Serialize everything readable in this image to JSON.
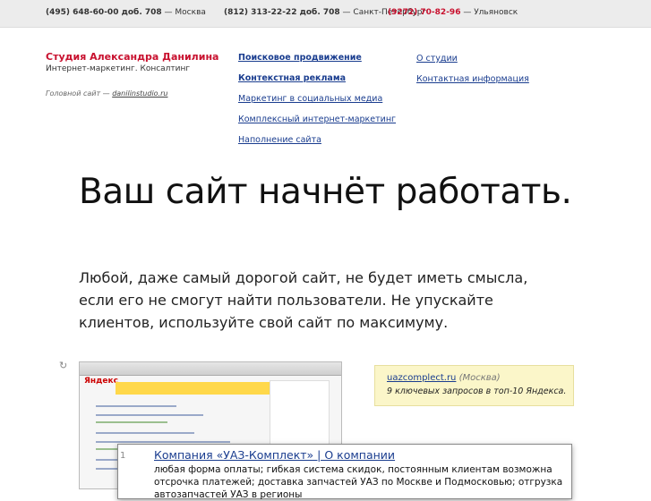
{
  "topbar": {
    "phone1": "(495) 648-60-00 доб. 708",
    "city1": "— Москва",
    "phone2": "(812) 313-22-22 доб. 708",
    "city2": "— Санкт-Петербург",
    "phone3": "(9272) 70-82-96",
    "city3": "— Ульяновск"
  },
  "brand": {
    "name": "Студия Александра Данилина",
    "tagline": "Интернет-маркетинг. Консалтинг",
    "main_site_label": "Головной сайт —",
    "main_site_link": "danilinstudio.ru"
  },
  "nav": {
    "items": [
      "Поисковое продвижение",
      "Контекстная реклама",
      "Маркетинг в социальных медиа",
      "Комплексный интернет-маркетинг",
      "Наполнение сайта"
    ],
    "secondary": [
      "О студии",
      "Контактная информация"
    ]
  },
  "hero": {
    "title": "Ваш сайт начнёт работать.",
    "text": "Любой, даже самый дорогой сайт, не будет иметь смысла, если его не смогут найти пользователи. Не упускайте клиентов, используйте свой сайт по максимуму."
  },
  "case": {
    "site_link": "uazcomplect.ru",
    "site_city": "(Москва)",
    "description": "9 ключевых запросов в топ-10 Яндекса.",
    "screenshot_logo": "Яндекс",
    "refresh_icon": "refresh-icon"
  },
  "popup": {
    "number": "1",
    "title": "Компания «УАЗ-Комплект» | О компании",
    "text": "любая форма оплаты; гибкая система скидок, постоянным клиентам возможна отсрочка платежей; доставка запчастей УАЗ по Москве и Подмосковью; отгрузка автозапчастей УАЗ в регионы"
  }
}
